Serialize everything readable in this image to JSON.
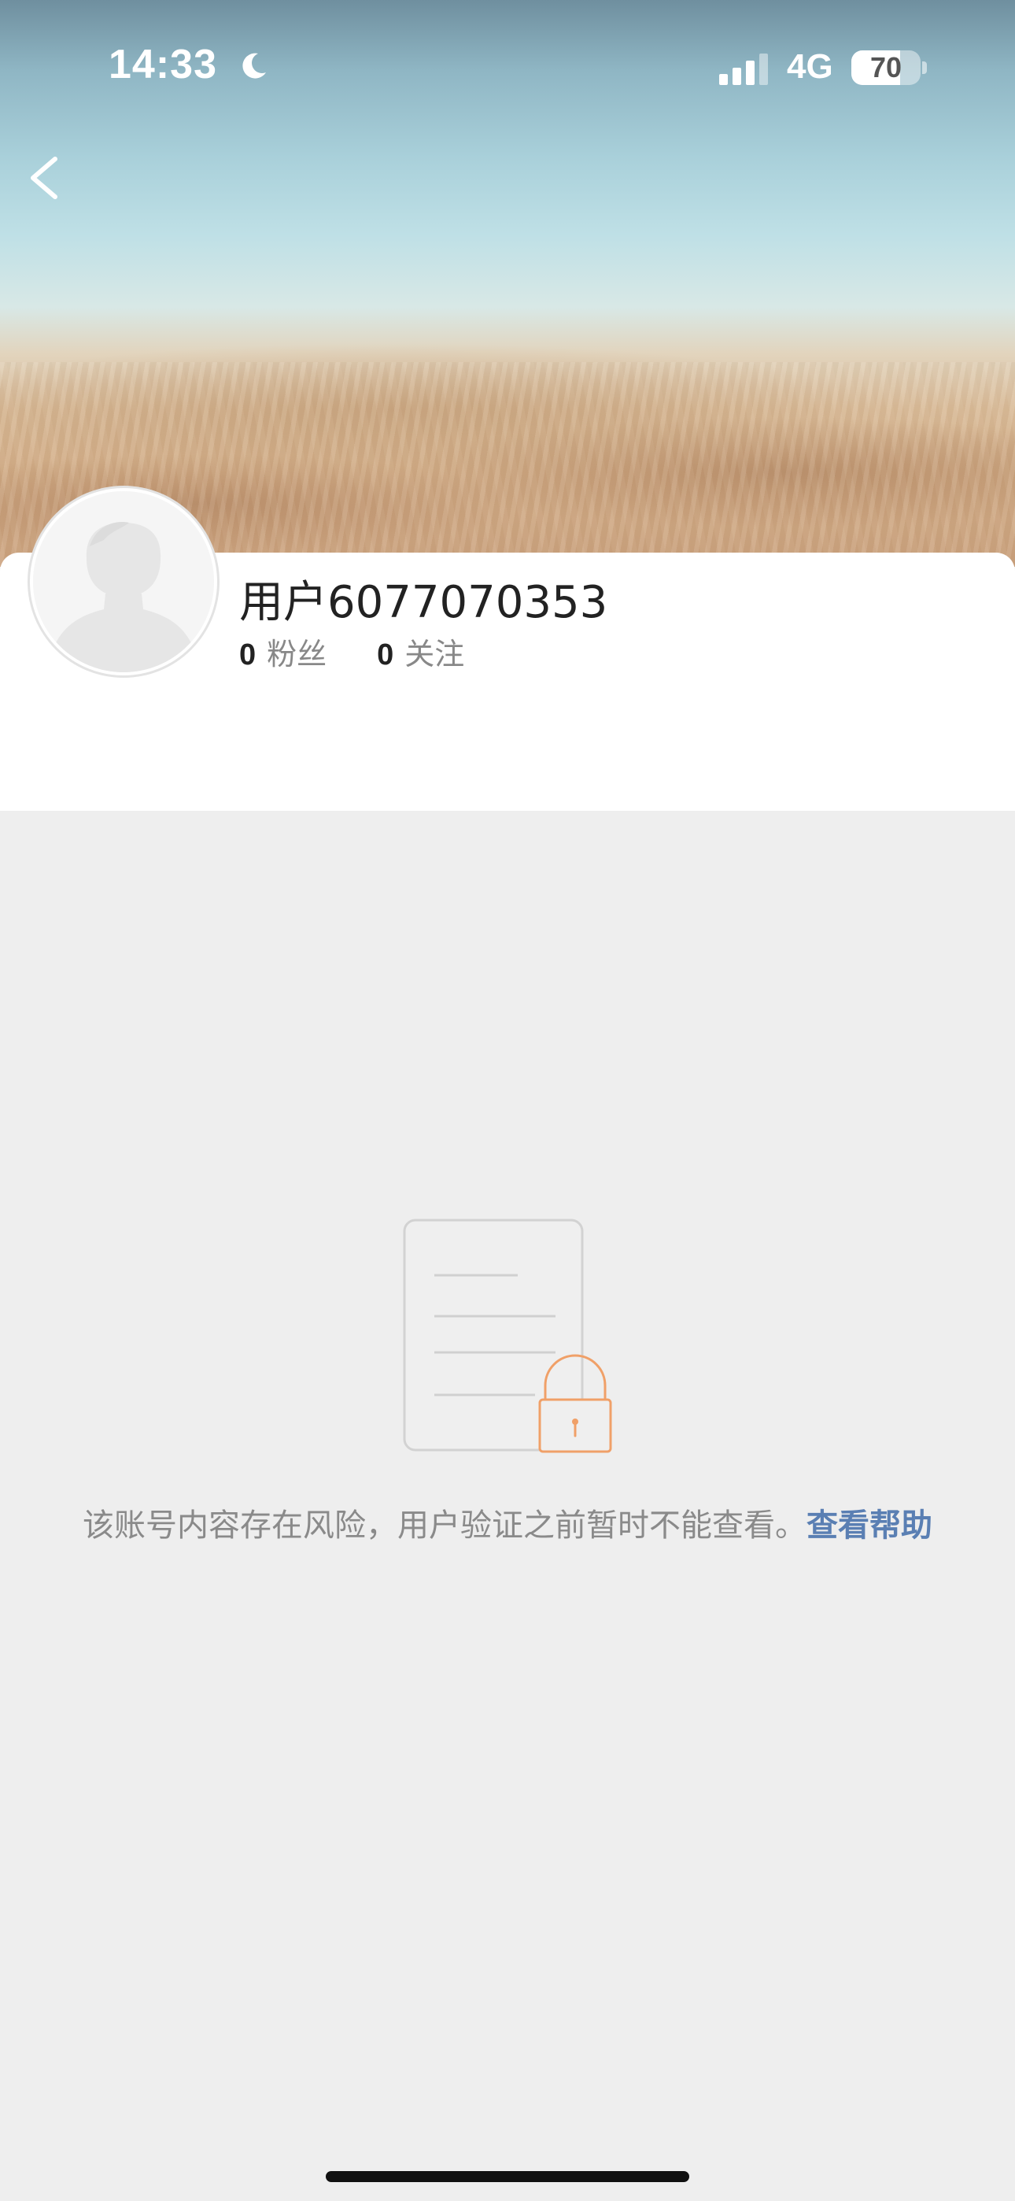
{
  "status_bar": {
    "time": "14:33",
    "network": "4G",
    "battery": "70",
    "battery_level": 0.7
  },
  "profile": {
    "username": "用户6077070353",
    "followers_count": "0",
    "followers_label": "粉丝",
    "following_count": "0",
    "following_label": "关注"
  },
  "locked": {
    "message": "该账号内容存在风险，用户验证之前暂时不能查看。",
    "help_link": "查看帮助"
  },
  "colors": {
    "link": "#5a7fb3",
    "lock_accent": "#f0a068",
    "background": "#eeeeee"
  },
  "icons": [
    "moon-icon",
    "signal-icon",
    "battery-icon",
    "back-arrow-icon",
    "avatar-placeholder-icon",
    "document-icon",
    "lock-icon"
  ]
}
